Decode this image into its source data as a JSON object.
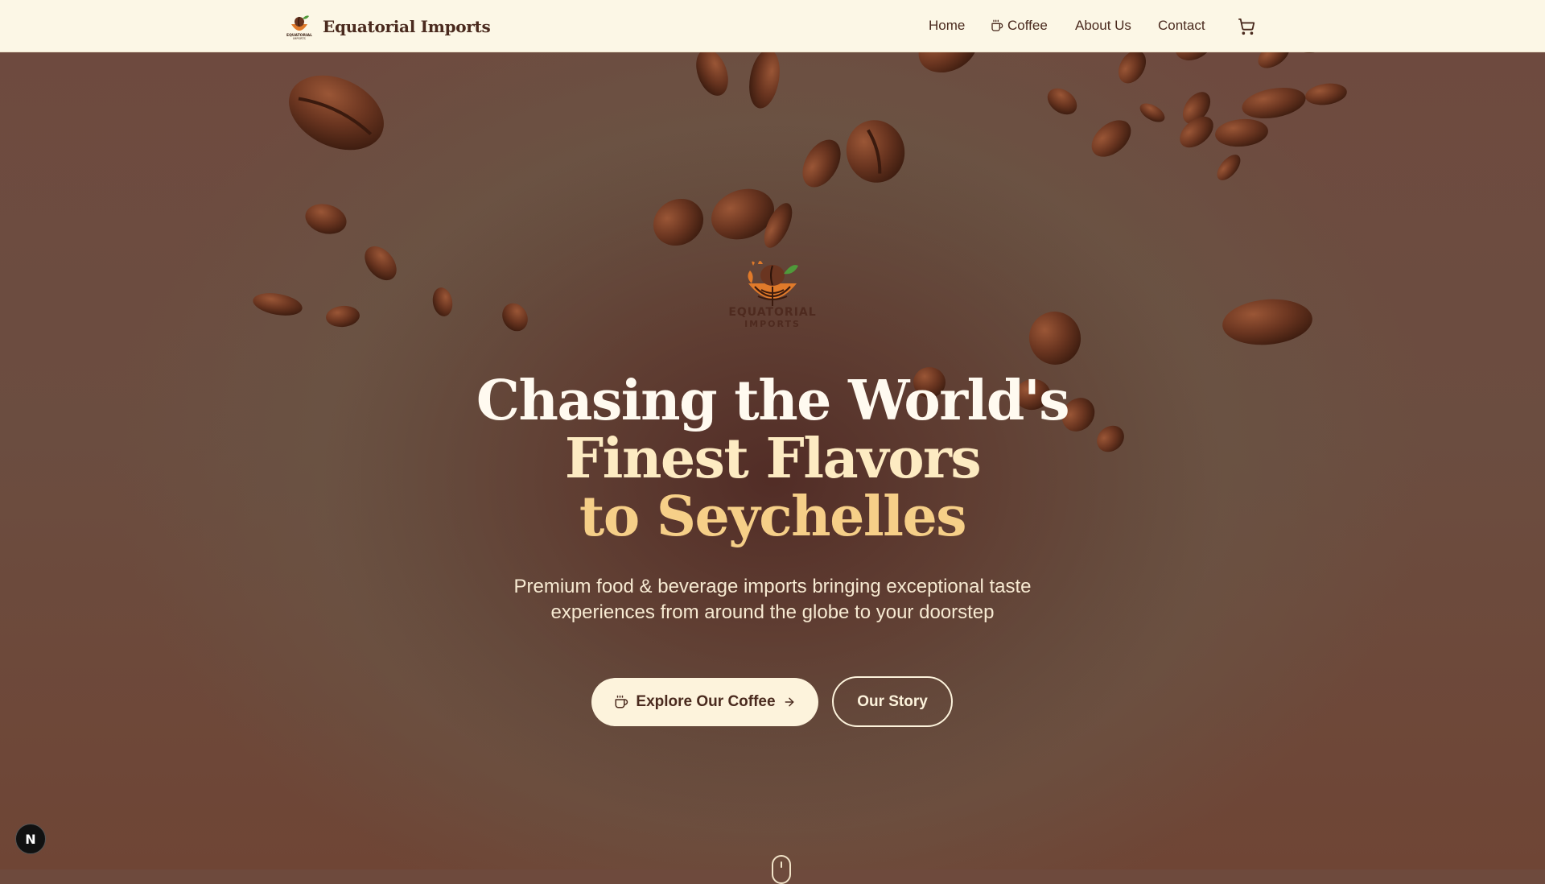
{
  "nav": {
    "brand_name": "Equatorial Imports",
    "logo_icon": "equatorial-imports-logo",
    "links": [
      {
        "label": "Home",
        "icon": null
      },
      {
        "label": "Coffee",
        "icon": "coffee-cup-icon"
      },
      {
        "label": "About Us",
        "icon": null
      },
      {
        "label": "Contact",
        "icon": null
      }
    ],
    "cart_icon": "shopping-cart-icon"
  },
  "hero": {
    "logo_line1": "EQUATORIAL",
    "logo_line2": "IMPORTS",
    "headline": [
      "Chasing the World's",
      "Finest Flavors",
      "to Seychelles"
    ],
    "subtext": [
      "Premium food & beverage imports bringing exceptional taste",
      "experiences from around the globe to your doorstep"
    ],
    "primary_button": {
      "label": "Explore Our Coffee",
      "icon": "coffee-cup-icon",
      "trailing_icon": "arrow-right-icon"
    },
    "secondary_button": {
      "label": "Our Story"
    },
    "scroll_indicator_icon": "mouse-scroll-icon"
  },
  "dev_badge": {
    "label": "N"
  },
  "colors": {
    "nav_bg": "#fcf7e6",
    "text_dark": "#4a2a1e",
    "hero_bg": "#6e4a3d",
    "headline_light": "#fffaf0",
    "headline_accent": "#f6cf88",
    "button_bg": "#fdf3dc",
    "bean": "#6a3520"
  }
}
